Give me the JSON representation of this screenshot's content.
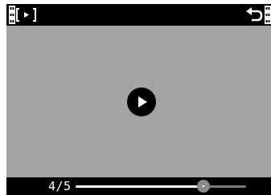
{
  "top_bar": {
    "left_icon": "video-playback-mode-icon",
    "right_icon": "return-back-icon"
  },
  "main": {
    "center_icon": "play-icon"
  },
  "bottom_bar": {
    "counter": "4/5",
    "progress_fraction": 0.75
  },
  "colors": {
    "background": "#a3a3a3",
    "bars": "#000000",
    "track": "#7a7a7a",
    "track_fill": "#ffffff",
    "thumb": "#8a8a8a"
  }
}
